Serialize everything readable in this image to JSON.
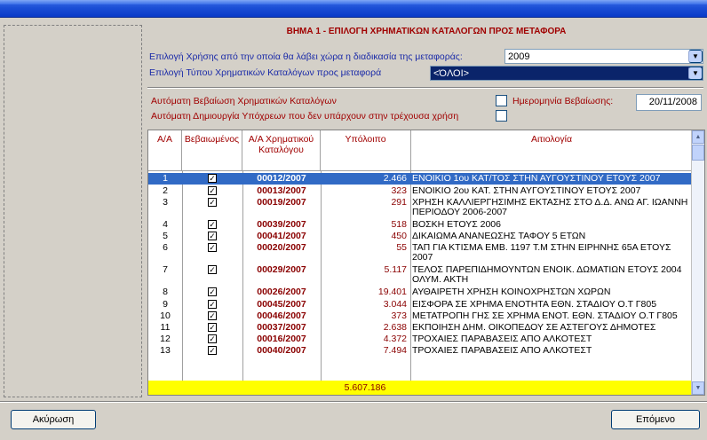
{
  "header": {
    "step_title": "ΒΗΜΑ 1 - ΕΠΙΛΟΓΗ ΧΡΗΜΑΤΙΚΩΝ ΚΑΤΑΛΟΓΩΝ ΠΡΟΣ ΜΕΤΑΦΟΡΑ",
    "year_label": "Επιλογή Χρήσης από την οποία θα λάβει χώρα η διαδικασία της μεταφοράς:",
    "year_value": "2009",
    "type_label": "Επιλογή Τύπου Χρηματικών Καταλόγων προς μεταφορά",
    "type_value": "<ΌΛΟΙ>"
  },
  "options": {
    "auto_confirm_label": "Αυτόματη Βεβαίωση Χρηματικών Καταλόγων",
    "confirm_date_label": "Ημερομηνία Βεβαίωσης:",
    "confirm_date_value": "20/11/2008",
    "auto_create_label": "Αυτόματη Δημιουργία Υπόχρεων που δεν υπάρχουν στην τρέχουσα χρήση"
  },
  "grid": {
    "headers": {
      "aa": "Α/Α",
      "confirmed": "Βεβαιωμένος",
      "code": "Α/Α Χρηματικού Καταλόγου",
      "balance": "Υπόλοιπο",
      "reason": "Αιτιολογία"
    },
    "rows": [
      {
        "aa": "1",
        "code": "00012/2007",
        "amount": "2.466",
        "desc": "ΕΝΟΙΚΙΟ 1ου ΚΑΤ/ΤΟΣ ΣΤΗΝ ΑΥΓΟΥΣΤΙΝΟΥ ΕΤΟΥΣ 2007",
        "check": "✓"
      },
      {
        "aa": "2",
        "code": "00013/2007",
        "amount": "323",
        "desc": "ΕΝΟΙΚΙΟ 2ου ΚΑΤ. ΣΤΗΝ ΑΥΓΟΥΣΤΙΝΟΥ ΕΤΟΥΣ 2007",
        "check": "✓"
      },
      {
        "aa": "3",
        "code": "00019/2007",
        "amount": "291",
        "desc": "ΧΡΗΣΗ ΚΑΛΛΙΕΡΓΗΣΙΜΗΣ ΕΚΤΑΣΗΣ ΣΤΟ Δ.Δ. ΑΝΩ ΑΓ. ΙΩΑΝΝΗ ΠΕΡΙΟΔΟΥ 2006-2007",
        "check": "✓"
      },
      {
        "aa": "4",
        "code": "00039/2007",
        "amount": "518",
        "desc": "ΒΟΣΚΗ ΕΤΟΥΣ 2006",
        "check": "✓"
      },
      {
        "aa": "5",
        "code": "00041/2007",
        "amount": "450",
        "desc": "ΔΙΚΑΙΩΜΑ ΑΝΑΝΕΩΣΗΣ ΤΑΦΟΥ 5 ΕΤΩΝ",
        "check": "✓"
      },
      {
        "aa": "6",
        "code": "00020/2007",
        "amount": "55",
        "desc": "ΤΑΠ ΓΙΑ ΚΤΙΣΜΑ ΕΜΒ. 1197 Τ.Μ ΣΤΗΝ ΕΙΡΗΝΗΣ 65Α ΕΤΟΥΣ 2007",
        "check": "✓"
      },
      {
        "aa": "7",
        "code": "00029/2007",
        "amount": "5.117",
        "desc": "ΤΕΛΟΣ ΠΑΡΕΠΙΔΗΜΟΥΝΤΩΝ ΕΝΟΙΚ. ΔΩΜΑΤΙΩΝ ΕΤΟΥΣ 2004 ΟΛΥΜ. ΑΚΤΗ",
        "check": "✓"
      },
      {
        "aa": "8",
        "code": "00026/2007",
        "amount": "19.401",
        "desc": "ΑΥΘΑΙΡΕΤΗ ΧΡΗΣΗ ΚΟΙΝΟΧΡΗΣΤΩΝ ΧΩΡΩΝ",
        "check": "✓"
      },
      {
        "aa": "9",
        "code": "00045/2007",
        "amount": "3.044",
        "desc": "ΕΙΣΦΟΡΑ ΣΕ ΧΡΗΜΑ ΕΝΟΤΗΤΑ ΕΘΝ. ΣΤΑΔΙΟΥ Ο.Τ Γ805",
        "check": "✓"
      },
      {
        "aa": "10",
        "code": "00046/2007",
        "amount": "373",
        "desc": "ΜΕΤΑΤΡΟΠΗ ΓΗΣ ΣΕ ΧΡΗΜΑ ΕΝΟΤ. ΕΘΝ. ΣΤΑΔΙΟΥ Ο.Τ Γ805",
        "check": "✓"
      },
      {
        "aa": "11",
        "code": "00037/2007",
        "amount": "2.638",
        "desc": "ΕΚΠΟΙΗΣΗ ΔΗΜ. ΟΙΚΟΠΕΔΟΥ ΣΕ ΑΣΤΕΓΟΥΣ ΔΗΜΟΤΕΣ",
        "check": "✓"
      },
      {
        "aa": "12",
        "code": "00016/2007",
        "amount": "4.372",
        "desc": "ΤΡΟΧΑΙΕΣ ΠΑΡΑΒΑΣΕΙΣ ΑΠΟ ΑΛΚΟΤΕΣΤ",
        "check": "✓"
      },
      {
        "aa": "13",
        "code": "00040/2007",
        "amount": "7.494",
        "desc": "ΤΡΟΧΑΙΕΣ ΠΑΡΑΒΑΣΕΙΣ ΑΠΟ ΑΛΚΟΤΕΣΤ",
        "check": "✓"
      }
    ],
    "total": "5.607.186"
  },
  "footer": {
    "cancel_label": "Ακύρωση",
    "next_label": "Επόμενο"
  },
  "icons": {
    "dropdown": "▼",
    "scroll_up": "▲",
    "scroll_down": "▼"
  }
}
